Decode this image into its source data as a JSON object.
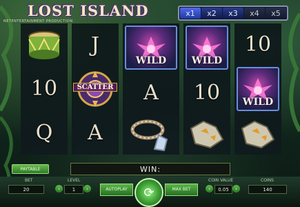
{
  "game": {
    "title": "LOST ISLAND",
    "producer": "NETENTERTAINMENT PRODUCTION"
  },
  "multipliers": [
    {
      "label": "x1",
      "state": "active"
    },
    {
      "label": "x2",
      "state": "normal"
    },
    {
      "label": "x3",
      "state": "normal"
    },
    {
      "label": "x4",
      "state": "dim"
    },
    {
      "label": "x5",
      "state": "dim"
    }
  ],
  "reels": [
    [
      {
        "symbol": "drum-icon"
      },
      {
        "symbol": "card-10",
        "text": "10"
      },
      {
        "symbol": "card-q",
        "text": "Q"
      }
    ],
    [
      {
        "symbol": "card-j",
        "text": "J"
      },
      {
        "symbol": "scatter-icon",
        "text": "SCATTER"
      },
      {
        "symbol": "card-a",
        "text": "A"
      }
    ],
    [
      {
        "symbol": "wild-flower-icon",
        "text": "WILD"
      },
      {
        "symbol": "card-a",
        "text": "A"
      },
      {
        "symbol": "pearl-necklace-icon"
      }
    ],
    [
      {
        "symbol": "wild-flower-icon",
        "text": "WILD"
      },
      {
        "symbol": "card-10",
        "text": "10"
      },
      {
        "symbol": "stone-idol-icon"
      }
    ],
    [
      {
        "symbol": "card-10",
        "text": "10"
      },
      {
        "symbol": "wild-flower-icon",
        "text": "WILD"
      },
      {
        "symbol": "stone-idol-icon"
      }
    ]
  ],
  "win": {
    "label": "WIN:"
  },
  "paytable": {
    "label": "PAYTABLE"
  },
  "controls": {
    "bet_label": "BET",
    "bet_value": "20",
    "level_label": "LEVEL",
    "level_value": "1",
    "autoplay_label": "AUTOPLAY",
    "max_bet_label": "MAX BET",
    "coin_value_label": "COIN VALUE",
    "coin_value": "0.05",
    "coins_label": "COINS",
    "coins_value": "140"
  },
  "colors": {
    "accent": "#4fa83f",
    "reel_frame": "#6a8de0",
    "title": "#f3e7c2"
  }
}
